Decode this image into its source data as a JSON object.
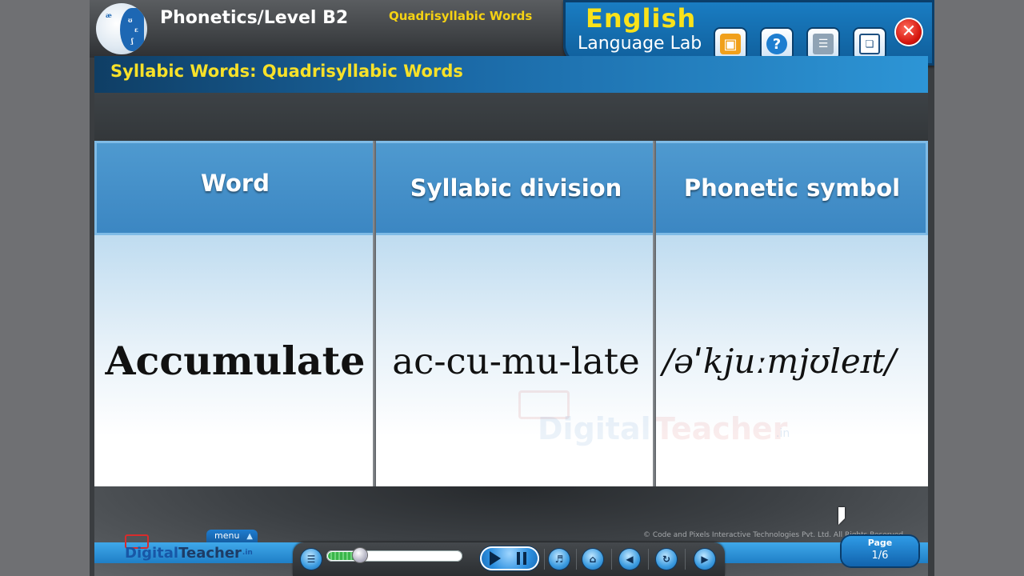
{
  "header": {
    "app_title": "Phonetics/Level B2",
    "lesson_title": "Quadrisyllabic Words",
    "brand_line1": "English",
    "brand_line2": "Language Lab",
    "logo_glyphs": [
      "æ",
      "ʊ",
      "ɛ",
      "ʃ"
    ]
  },
  "section": {
    "title": "Syllabic Words: Quadrisyllabic Words"
  },
  "table": {
    "headers": [
      "Word",
      "Syllabic division",
      "Phonetic symbol"
    ],
    "rows": [
      {
        "word": "Accumulate",
        "syllabic_division": "ac-cu-mu-late",
        "phonetic_symbol": "/əˈkjuːmjʊleɪt/"
      }
    ]
  },
  "watermark": {
    "digital": "Digital",
    "teacher": "Teacher",
    "suffix": ".in"
  },
  "footer": {
    "copyright": "© Code and Pixels Interactive Technologies  Pvt. Ltd. All Rights Reserved",
    "menu_label": "menu",
    "logo_digital": "Digital",
    "logo_teacher": "Teacher",
    "logo_suffix": ".in",
    "progress_fraction": 0.22,
    "page_label": "Page",
    "page_number": "1/6"
  },
  "colors": {
    "accent_blue": "#1f7fc6",
    "title_yellow": "#f7e129",
    "close_red": "#d4140c"
  },
  "icons": [
    "wallet-icon",
    "help-icon",
    "book-icon",
    "window-icon",
    "close-icon",
    "menu-tree-icon",
    "play-icon",
    "pause-icon",
    "volume-icon",
    "home-icon",
    "previous-icon",
    "replay-icon",
    "next-icon"
  ]
}
